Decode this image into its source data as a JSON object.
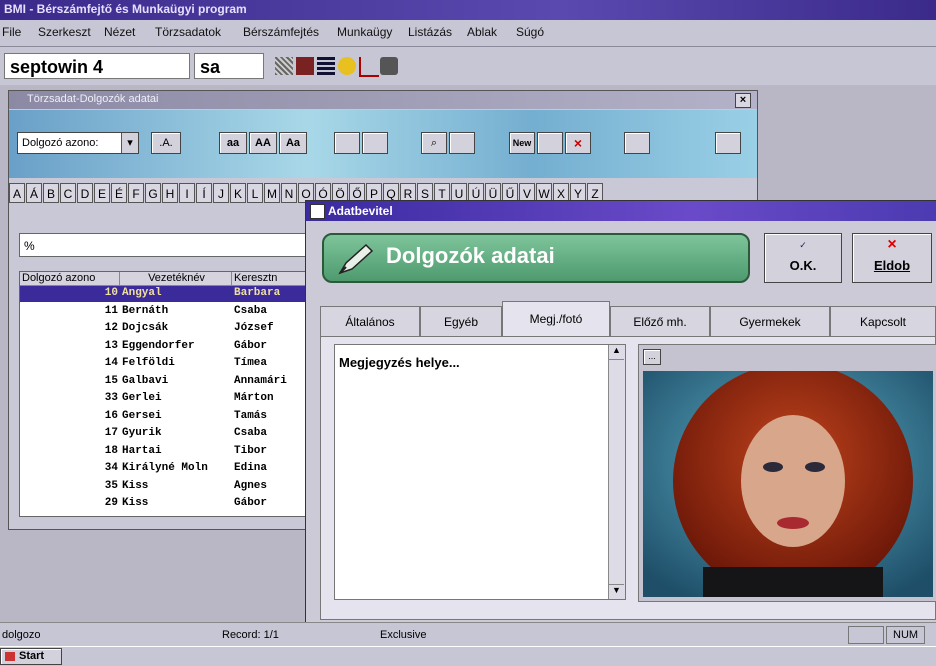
{
  "app": {
    "title": "BMI - Bérszámfejtő és Munkaügyi program",
    "menu": [
      "File",
      "Szerkeszt",
      "Nézet",
      "Törzsadatok",
      "Bérszámfejtés",
      "Munkaügy",
      "Listázás",
      "Ablak",
      "Súgó"
    ],
    "toolbar": {
      "field1": "septowin 4",
      "field2": "sa"
    }
  },
  "employees_window": {
    "title": "Törzsadat-Dolgozók adatai",
    "sort_select": "Dolgozó azono:",
    "case_buttons": [
      "aa",
      "AA",
      "Aa"
    ],
    "alphabet": [
      "A",
      "Á",
      "B",
      "C",
      "D",
      "E",
      "É",
      "F",
      "G",
      "H",
      "I",
      "Í",
      "J",
      "K",
      "L",
      "M",
      "N",
      "O",
      "Ó",
      "Ö",
      "Ő",
      "P",
      "Q",
      "R",
      "S",
      "T",
      "U",
      "Ú",
      "Ü",
      "Ű",
      "V",
      "W",
      "X",
      "Y",
      "Z"
    ],
    "filter_value": "%",
    "columns": [
      "Dolgozó azono",
      "Vezetéknév",
      "Keresztn"
    ],
    "rows": [
      {
        "id": "10",
        "last": "Angyal",
        "first": "Barbara",
        "selected": true
      },
      {
        "id": "11",
        "last": "Bernáth",
        "first": "Csaba"
      },
      {
        "id": "12",
        "last": "Dojcsák",
        "first": "József"
      },
      {
        "id": "13",
        "last": "Eggendorfer",
        "first": "Gábor"
      },
      {
        "id": "14",
        "last": "Felföldi",
        "first": "Tímea"
      },
      {
        "id": "15",
        "last": "Galbavi",
        "first": "Annamári"
      },
      {
        "id": "33",
        "last": "Gerlei",
        "first": "Márton"
      },
      {
        "id": "16",
        "last": "Gersei",
        "first": "Tamás"
      },
      {
        "id": "17",
        "last": "Gyurik",
        "first": "Csaba"
      },
      {
        "id": "18",
        "last": "Hartai",
        "first": "Tibor"
      },
      {
        "id": "34",
        "last": "Királyné Moln",
        "first": "Edina"
      },
      {
        "id": "35",
        "last": "Kiss",
        "first": "Ágnes"
      },
      {
        "id": "29",
        "last": "Kiss",
        "first": "Gábor"
      }
    ]
  },
  "dialog": {
    "title": "Adatbevitel",
    "banner": "Dolgozók adatai",
    "ok_label": "O.K.",
    "cancel_label": "Eldob",
    "tabs": [
      "Általános",
      "Egyéb",
      "Megj./fotó",
      "Előző mh.",
      "Gyermekek",
      "Kapcsolt"
    ],
    "active_tab": "Megj./fotó",
    "notes_text": "Megjegyzés helye...",
    "small_button": "..."
  },
  "status": {
    "left": "dolgozo",
    "record": "Record: 1/1",
    "mode": "Exclusive",
    "num": "NUM"
  },
  "taskbar": {
    "start": "Start"
  },
  "colors": {
    "selection": "#3a2a9a",
    "dialog_title": "#3a2aa0",
    "banner": "#5aa67a"
  }
}
